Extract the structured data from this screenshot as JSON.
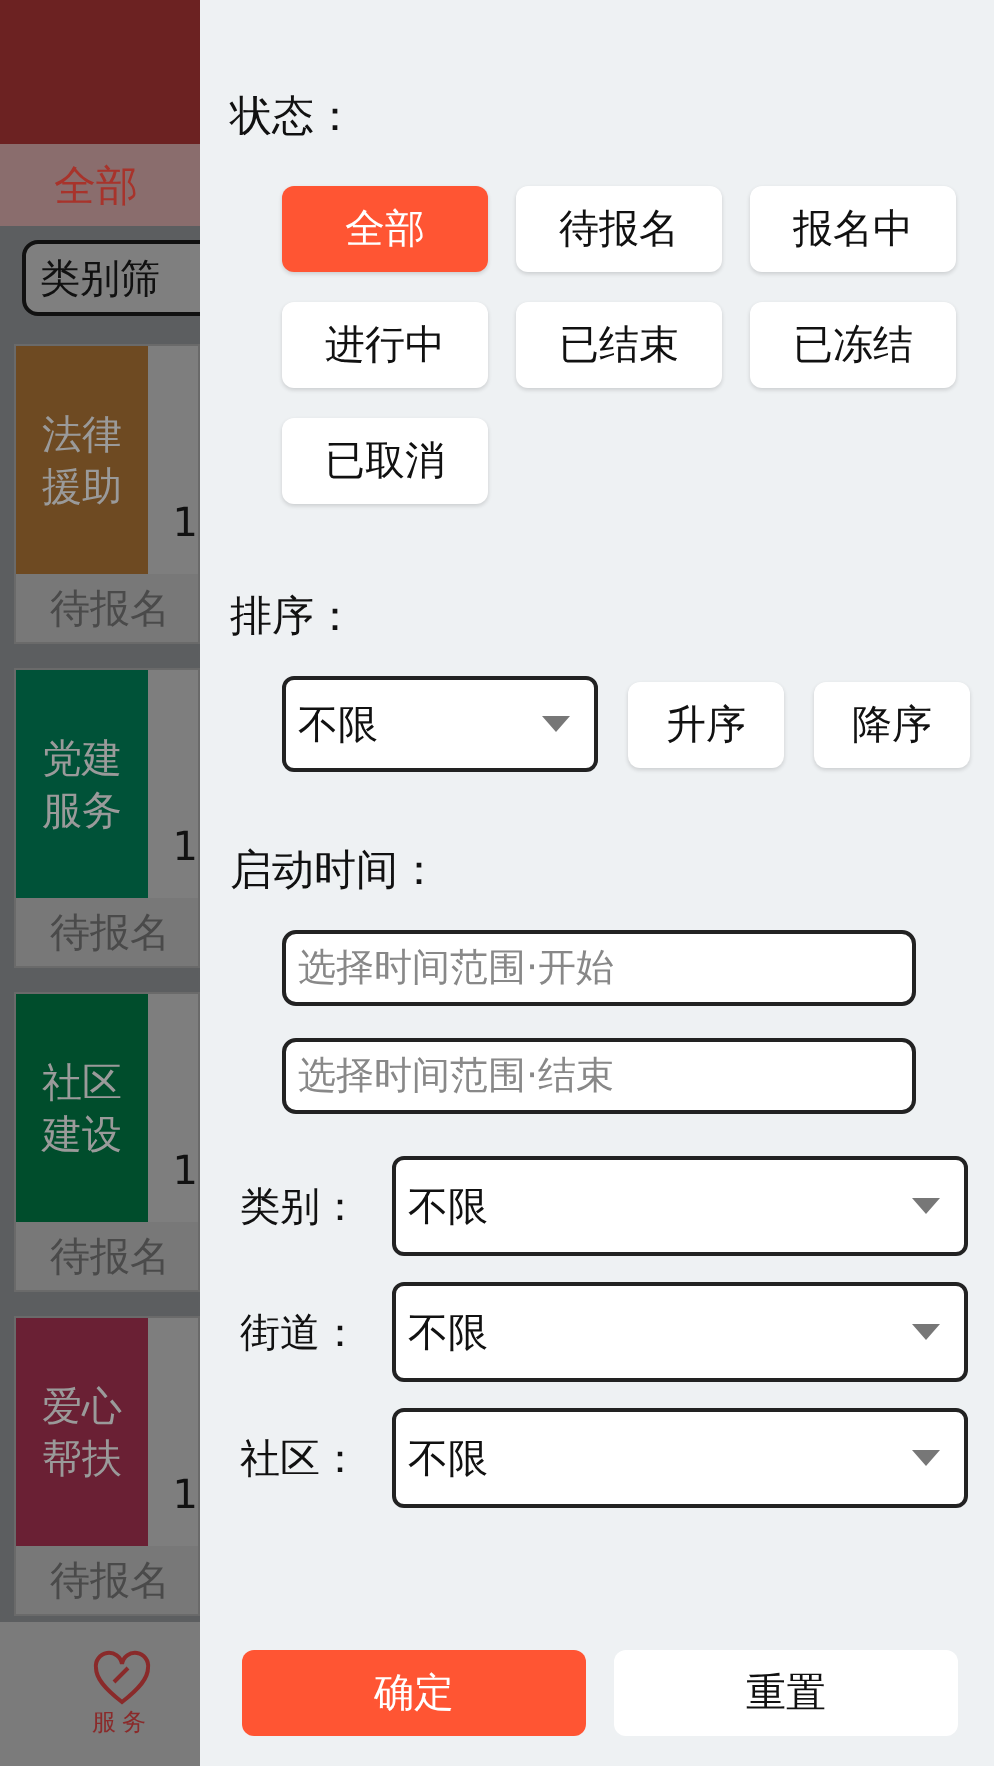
{
  "background": {
    "tab": {
      "label": "全部",
      "selected": true
    },
    "category_select": {
      "value": "类别筛"
    },
    "cards": [
      {
        "category": "法律援助",
        "color": "#6e4a22",
        "number": "1",
        "status": "待报名"
      },
      {
        "category": "党建服务",
        "color": "#005238",
        "number": "1",
        "status": "待报名"
      },
      {
        "category": "社区建设",
        "color": "#004d2c",
        "number": "1",
        "status": "待报名"
      },
      {
        "category": "爱心帮扶",
        "color": "#6a2034",
        "number": "1",
        "status": "待报名"
      }
    ],
    "bottom_nav": [
      {
        "label": "服务",
        "selected": true
      }
    ]
  },
  "drawer": {
    "status": {
      "label": "状态：",
      "options": [
        {
          "label": "全部",
          "selected": true
        },
        {
          "label": "待报名",
          "selected": false
        },
        {
          "label": "报名中",
          "selected": false
        },
        {
          "label": "进行中",
          "selected": false
        },
        {
          "label": "已结束",
          "selected": false
        },
        {
          "label": "已冻结",
          "selected": false
        },
        {
          "label": "已取消",
          "selected": false
        }
      ]
    },
    "sort": {
      "label": "排序：",
      "value": "不限",
      "buttons": [
        "升序",
        "降序"
      ]
    },
    "start_time": {
      "label": "启动时间：",
      "fields": [
        {
          "placeholder": "选择时间范围·开始"
        },
        {
          "placeholder": "选择时间范围·结束"
        }
      ]
    },
    "filters": [
      {
        "label": "类别：",
        "value": "不限"
      },
      {
        "label": "街道：",
        "value": "不限"
      },
      {
        "label": "社区：",
        "value": "不限"
      }
    ],
    "actions": [
      {
        "label": "确定",
        "kind": "primary"
      },
      {
        "label": "重置",
        "kind": "secondary"
      }
    ]
  }
}
